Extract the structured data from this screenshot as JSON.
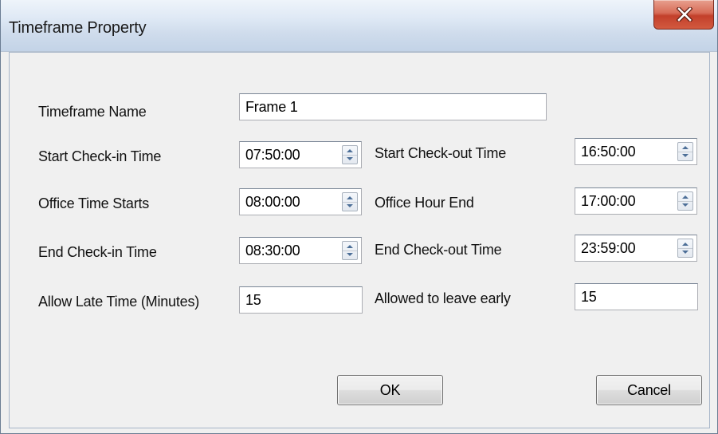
{
  "window": {
    "title": "Timeframe Property",
    "close_icon": "close-x-icon"
  },
  "form": {
    "timeframe_name": {
      "label": "Timeframe Name",
      "value": "Frame 1"
    },
    "start_checkin": {
      "label": "Start Check-in Time",
      "value": "07:50:00"
    },
    "office_starts": {
      "label": "Office Time Starts",
      "value": "08:00:00"
    },
    "end_checkin": {
      "label": "End Check-in Time",
      "value": "08:30:00"
    },
    "allow_late": {
      "label": "Allow Late Time (Minutes)",
      "value": "15"
    },
    "start_checkout": {
      "label": "Start Check-out Time",
      "value": "16:50:00"
    },
    "office_end": {
      "label": "Office Hour End",
      "value": "17:00:00"
    },
    "end_checkout": {
      "label": "End Check-out Time",
      "value": "23:59:00"
    },
    "leave_early": {
      "label": "Allowed to leave early",
      "value": "15"
    }
  },
  "buttons": {
    "ok_label": "OK",
    "cancel_label": "Cancel"
  }
}
